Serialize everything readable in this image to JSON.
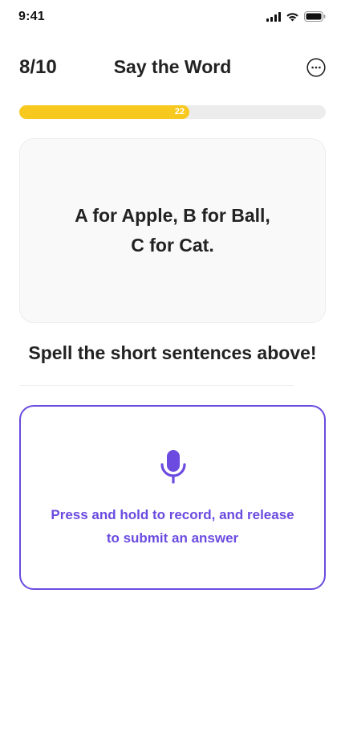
{
  "status_bar": {
    "time": "9:41"
  },
  "header": {
    "progress_count": "8/10",
    "title": "Say the Word"
  },
  "progress": {
    "label": "22",
    "fraction": 0.555
  },
  "card": {
    "lines": [
      "A for Apple, B for Ball,",
      "C for Cat."
    ]
  },
  "instruction": "Spell the short sentences above!",
  "record": {
    "hint_lines": [
      "Press and hold to record, and release",
      "to submit an answer"
    ]
  },
  "colors": {
    "accent": "#6b4be0",
    "progress": "#f7c81e",
    "track": "#ececec",
    "card_bg": "#f9f9f9"
  },
  "icons": [
    "signal-icon",
    "wifi-icon",
    "battery-icon",
    "more-icon",
    "microphone-icon"
  ]
}
